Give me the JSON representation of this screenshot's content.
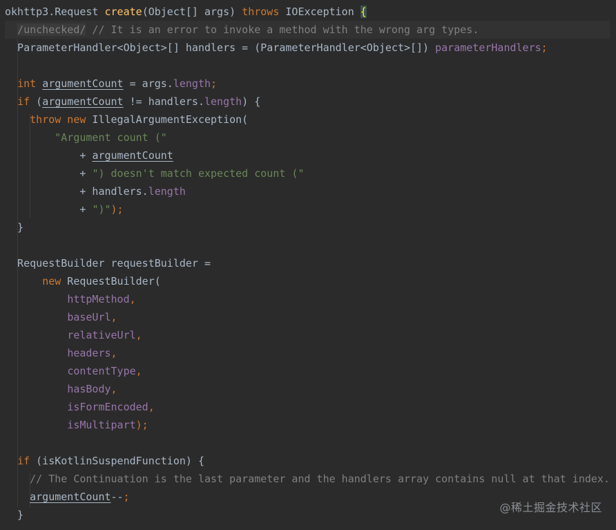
{
  "editor": {
    "language": "java",
    "theme_colors": {
      "background": "#2b2b2b",
      "plain": "#a9b7c6",
      "keyword": "#cc7832",
      "method": "#ffc66d",
      "field": "#9876aa",
      "string": "#6a8759",
      "comment": "#808080"
    },
    "lines": [
      {
        "tokens": [
          [
            "okhttp3.Request ",
            "plain"
          ],
          [
            "create",
            "fn"
          ],
          [
            "(Object[] args) ",
            "plain"
          ],
          [
            "throws",
            "kw"
          ],
          [
            " IOException ",
            "plain"
          ],
          [
            "{",
            "brace"
          ]
        ]
      },
      {
        "highlight": true,
        "tokens": [
          [
            "  ",
            "plain"
          ],
          [
            "/unchecked/",
            "supp"
          ],
          [
            " // It is an error to invoke a method with the wrong arg types.",
            "comment"
          ]
        ]
      },
      {
        "tokens": [
          [
            "  ParameterHandler<Object>[] handlers = (ParameterHandler<Object>[]) ",
            "plain"
          ],
          [
            "parameterHandlers",
            "field"
          ],
          [
            ";",
            "kw"
          ]
        ]
      },
      {
        "tokens": []
      },
      {
        "tokens": [
          [
            "  ",
            "plain"
          ],
          [
            "int",
            "kw"
          ],
          [
            " ",
            "plain"
          ],
          [
            "argumentCount",
            "plain",
            "u"
          ],
          [
            " = args.",
            "plain"
          ],
          [
            "length",
            "field"
          ],
          [
            ";",
            "kw"
          ]
        ]
      },
      {
        "tokens": [
          [
            "  ",
            "plain"
          ],
          [
            "if",
            "kw"
          ],
          [
            " (",
            "plain"
          ],
          [
            "argumentCount",
            "plain",
            "u"
          ],
          [
            " != handlers.",
            "plain"
          ],
          [
            "length",
            "field"
          ],
          [
            ") {",
            "plain"
          ]
        ]
      },
      {
        "tokens": [
          [
            "    ",
            "plain"
          ],
          [
            "throw new",
            "kw"
          ],
          [
            " IllegalArgumentException(",
            "plain"
          ]
        ]
      },
      {
        "tokens": [
          [
            "        ",
            "plain"
          ],
          [
            "\"Argument count (\"",
            "str"
          ]
        ]
      },
      {
        "tokens": [
          [
            "            + ",
            "plain"
          ],
          [
            "argumentCount",
            "plain",
            "u"
          ]
        ]
      },
      {
        "tokens": [
          [
            "            + ",
            "plain"
          ],
          [
            "\") doesn't match expected count (\"",
            "str"
          ]
        ]
      },
      {
        "tokens": [
          [
            "            + handlers.",
            "plain"
          ],
          [
            "length",
            "field"
          ]
        ]
      },
      {
        "tokens": [
          [
            "            + ",
            "plain"
          ],
          [
            "\")\"",
            "str"
          ],
          [
            ");",
            "kw"
          ]
        ]
      },
      {
        "tokens": [
          [
            "  }",
            "plain"
          ]
        ]
      },
      {
        "tokens": []
      },
      {
        "tokens": [
          [
            "  RequestBuilder requestBuilder =",
            "plain"
          ]
        ]
      },
      {
        "tokens": [
          [
            "      ",
            "plain"
          ],
          [
            "new",
            "kw"
          ],
          [
            " RequestBuilder(",
            "plain"
          ]
        ]
      },
      {
        "tokens": [
          [
            "          ",
            "plain"
          ],
          [
            "httpMethod",
            "field"
          ],
          [
            ",",
            "kw"
          ]
        ]
      },
      {
        "tokens": [
          [
            "          ",
            "plain"
          ],
          [
            "baseUrl",
            "field"
          ],
          [
            ",",
            "kw"
          ]
        ]
      },
      {
        "tokens": [
          [
            "          ",
            "plain"
          ],
          [
            "relativeUrl",
            "field"
          ],
          [
            ",",
            "kw"
          ]
        ]
      },
      {
        "tokens": [
          [
            "          ",
            "plain"
          ],
          [
            "headers",
            "field"
          ],
          [
            ",",
            "kw"
          ]
        ]
      },
      {
        "tokens": [
          [
            "          ",
            "plain"
          ],
          [
            "contentType",
            "field"
          ],
          [
            ",",
            "kw"
          ]
        ]
      },
      {
        "tokens": [
          [
            "          ",
            "plain"
          ],
          [
            "hasBody",
            "field"
          ],
          [
            ",",
            "kw"
          ]
        ]
      },
      {
        "tokens": [
          [
            "          ",
            "plain"
          ],
          [
            "isFormEncoded",
            "field"
          ],
          [
            ",",
            "kw"
          ]
        ]
      },
      {
        "tokens": [
          [
            "          ",
            "plain"
          ],
          [
            "isMultipart",
            "field"
          ],
          [
            ");",
            "kw"
          ]
        ]
      },
      {
        "tokens": []
      },
      {
        "tokens": [
          [
            "  ",
            "plain"
          ],
          [
            "if",
            "kw"
          ],
          [
            " (isKotlinSuspendFunction) {",
            "plain"
          ]
        ]
      },
      {
        "tokens": [
          [
            "    ",
            "plain"
          ],
          [
            "// The Continuation is the last parameter and the handlers array contains null at that index.",
            "comment"
          ]
        ]
      },
      {
        "tokens": [
          [
            "    ",
            "plain"
          ],
          [
            "argumentCount",
            "plain",
            "u"
          ],
          [
            "--",
            "plain"
          ],
          [
            ";",
            "kw"
          ]
        ]
      },
      {
        "tokens": [
          [
            "  }",
            "plain"
          ]
        ]
      }
    ]
  },
  "watermark": "@稀土掘金技术社区"
}
